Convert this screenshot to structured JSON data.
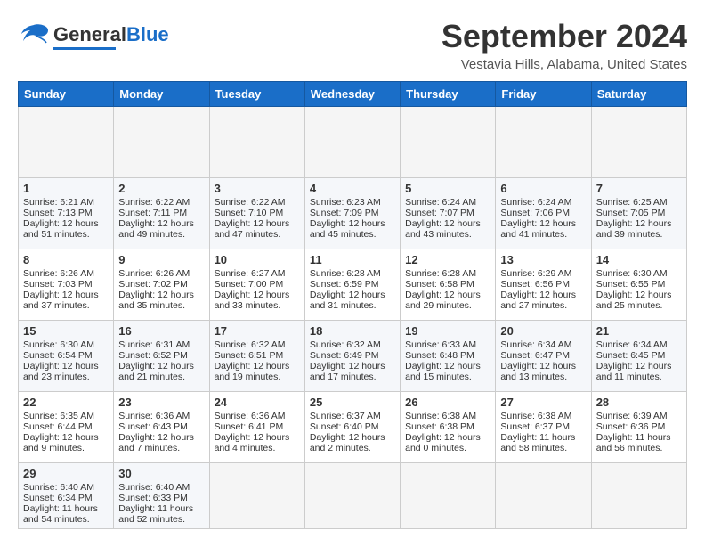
{
  "header": {
    "logo_general": "General",
    "logo_blue": "Blue",
    "month_title": "September 2024",
    "location": "Vestavia Hills, Alabama, United States"
  },
  "calendar": {
    "days_of_week": [
      "Sunday",
      "Monday",
      "Tuesday",
      "Wednesday",
      "Thursday",
      "Friday",
      "Saturday"
    ],
    "weeks": [
      [
        {
          "day": "",
          "empty": true
        },
        {
          "day": "",
          "empty": true
        },
        {
          "day": "",
          "empty": true
        },
        {
          "day": "",
          "empty": true
        },
        {
          "day": "",
          "empty": true
        },
        {
          "day": "",
          "empty": true
        },
        {
          "day": "",
          "empty": true
        }
      ],
      [
        {
          "num": "1",
          "sunrise": "6:21 AM",
          "sunset": "7:13 PM",
          "daylight": "12 hours and 51 minutes."
        },
        {
          "num": "2",
          "sunrise": "6:22 AM",
          "sunset": "7:11 PM",
          "daylight": "12 hours and 49 minutes."
        },
        {
          "num": "3",
          "sunrise": "6:22 AM",
          "sunset": "7:10 PM",
          "daylight": "12 hours and 47 minutes."
        },
        {
          "num": "4",
          "sunrise": "6:23 AM",
          "sunset": "7:09 PM",
          "daylight": "12 hours and 45 minutes."
        },
        {
          "num": "5",
          "sunrise": "6:24 AM",
          "sunset": "7:07 PM",
          "daylight": "12 hours and 43 minutes."
        },
        {
          "num": "6",
          "sunrise": "6:24 AM",
          "sunset": "7:06 PM",
          "daylight": "12 hours and 41 minutes."
        },
        {
          "num": "7",
          "sunrise": "6:25 AM",
          "sunset": "7:05 PM",
          "daylight": "12 hours and 39 minutes."
        }
      ],
      [
        {
          "num": "8",
          "sunrise": "6:26 AM",
          "sunset": "7:03 PM",
          "daylight": "12 hours and 37 minutes."
        },
        {
          "num": "9",
          "sunrise": "6:26 AM",
          "sunset": "7:02 PM",
          "daylight": "12 hours and 35 minutes."
        },
        {
          "num": "10",
          "sunrise": "6:27 AM",
          "sunset": "7:00 PM",
          "daylight": "12 hours and 33 minutes."
        },
        {
          "num": "11",
          "sunrise": "6:28 AM",
          "sunset": "6:59 PM",
          "daylight": "12 hours and 31 minutes."
        },
        {
          "num": "12",
          "sunrise": "6:28 AM",
          "sunset": "6:58 PM",
          "daylight": "12 hours and 29 minutes."
        },
        {
          "num": "13",
          "sunrise": "6:29 AM",
          "sunset": "6:56 PM",
          "daylight": "12 hours and 27 minutes."
        },
        {
          "num": "14",
          "sunrise": "6:30 AM",
          "sunset": "6:55 PM",
          "daylight": "12 hours and 25 minutes."
        }
      ],
      [
        {
          "num": "15",
          "sunrise": "6:30 AM",
          "sunset": "6:54 PM",
          "daylight": "12 hours and 23 minutes."
        },
        {
          "num": "16",
          "sunrise": "6:31 AM",
          "sunset": "6:52 PM",
          "daylight": "12 hours and 21 minutes."
        },
        {
          "num": "17",
          "sunrise": "6:32 AM",
          "sunset": "6:51 PM",
          "daylight": "12 hours and 19 minutes."
        },
        {
          "num": "18",
          "sunrise": "6:32 AM",
          "sunset": "6:49 PM",
          "daylight": "12 hours and 17 minutes."
        },
        {
          "num": "19",
          "sunrise": "6:33 AM",
          "sunset": "6:48 PM",
          "daylight": "12 hours and 15 minutes."
        },
        {
          "num": "20",
          "sunrise": "6:34 AM",
          "sunset": "6:47 PM",
          "daylight": "12 hours and 13 minutes."
        },
        {
          "num": "21",
          "sunrise": "6:34 AM",
          "sunset": "6:45 PM",
          "daylight": "12 hours and 11 minutes."
        }
      ],
      [
        {
          "num": "22",
          "sunrise": "6:35 AM",
          "sunset": "6:44 PM",
          "daylight": "12 hours and 9 minutes."
        },
        {
          "num": "23",
          "sunrise": "6:36 AM",
          "sunset": "6:43 PM",
          "daylight": "12 hours and 7 minutes."
        },
        {
          "num": "24",
          "sunrise": "6:36 AM",
          "sunset": "6:41 PM",
          "daylight": "12 hours and 4 minutes."
        },
        {
          "num": "25",
          "sunrise": "6:37 AM",
          "sunset": "6:40 PM",
          "daylight": "12 hours and 2 minutes."
        },
        {
          "num": "26",
          "sunrise": "6:38 AM",
          "sunset": "6:38 PM",
          "daylight": "12 hours and 0 minutes."
        },
        {
          "num": "27",
          "sunrise": "6:38 AM",
          "sunset": "6:37 PM",
          "daylight": "11 hours and 58 minutes."
        },
        {
          "num": "28",
          "sunrise": "6:39 AM",
          "sunset": "6:36 PM",
          "daylight": "11 hours and 56 minutes."
        }
      ],
      [
        {
          "num": "29",
          "sunrise": "6:40 AM",
          "sunset": "6:34 PM",
          "daylight": "11 hours and 54 minutes."
        },
        {
          "num": "30",
          "sunrise": "6:40 AM",
          "sunset": "6:33 PM",
          "daylight": "11 hours and 52 minutes."
        },
        {
          "num": "",
          "empty": true
        },
        {
          "num": "",
          "empty": true
        },
        {
          "num": "",
          "empty": true
        },
        {
          "num": "",
          "empty": true
        },
        {
          "num": "",
          "empty": true
        }
      ]
    ]
  }
}
